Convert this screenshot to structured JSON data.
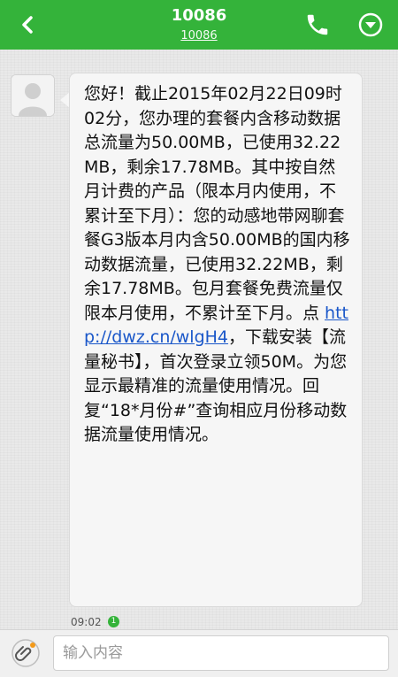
{
  "header": {
    "title": "10086",
    "subtitle": "10086",
    "back_icon": "chevron-left-icon",
    "call_icon": "phone-icon",
    "menu_icon": "chevron-down-circle-icon",
    "bg_color": "#34b33a"
  },
  "message": {
    "text_before_link": "您好！截止2015年02月22日09时02分，您办理的套餐内含移动数据总流量为50.00MB，已使用32.22MB，剩余17.78MB。其中按自然月计费的产品（限本月内使用，不累计至下月）：您的动感地带网聊套餐G3版本月内含50.00MB的国内移动数据流量，已使用32.22MB，剩余17.78MB。包月套餐免费流量仅限本月使用，不累计至下月。点 ",
    "link": "http://dwz.cn/wlgH4",
    "text_after_link": "，下载安装【流量秘书】，首次登录立领50M。为您显示最精准的流量使用情况。回复“18*月份#”查询相应月份移动数据流量使用情况。",
    "time": "09:02",
    "status": "1"
  },
  "composer": {
    "placeholder": "输入内容",
    "attach_icon": "paperclip-icon"
  }
}
